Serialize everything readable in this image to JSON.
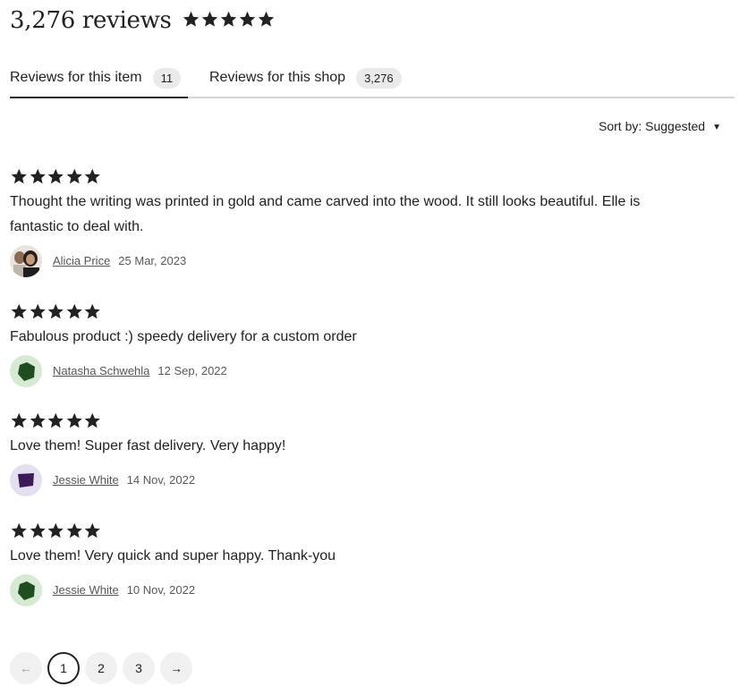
{
  "header": {
    "title": "3,276 reviews",
    "rating": 5
  },
  "tabs": [
    {
      "label": "Reviews for this item",
      "count": "11"
    },
    {
      "label": "Reviews for this shop",
      "count": "3,276"
    }
  ],
  "sort": {
    "label": "Sort by: Suggested"
  },
  "reviews": [
    {
      "rating": 5,
      "text": "Thought the writing was printed in gold and came carved into the wood. It still looks beautiful. Elle is fantastic to deal with.",
      "author": "Alicia Price",
      "date": "25 Mar, 2023",
      "avatar": "photo"
    },
    {
      "rating": 5,
      "text": "Fabulous product :) speedy delivery for a custom order",
      "author": "Natasha Schwehla",
      "date": "12 Sep, 2022",
      "avatar": "green-pentagon"
    },
    {
      "rating": 5,
      "text": "Love them! Super fast delivery. Very happy!",
      "author": "Jessie White",
      "date": "14 Nov, 2022",
      "avatar": "purple-shape"
    },
    {
      "rating": 5,
      "text": "Love them! Very quick and super happy. Thank-you",
      "author": "Jessie White",
      "date": "10 Nov, 2022",
      "avatar": "green-pentagon"
    }
  ],
  "pagination": {
    "prev": "←",
    "pages": [
      "1",
      "2",
      "3"
    ],
    "current": "1",
    "next": "→"
  }
}
